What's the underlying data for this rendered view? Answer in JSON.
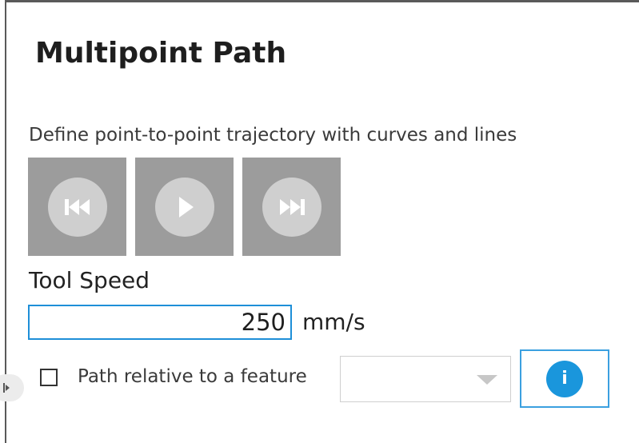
{
  "panel": {
    "title": "Multipoint Path",
    "description": "Define point-to-point trajectory with curves and lines"
  },
  "playback": {
    "buttons": [
      {
        "name": "previous",
        "icon": "skip-back-icon"
      },
      {
        "name": "play",
        "icon": "play-icon"
      },
      {
        "name": "next",
        "icon": "skip-forward-icon"
      }
    ]
  },
  "tool_speed": {
    "label": "Tool Speed",
    "value": "250",
    "unit": "mm/s"
  },
  "feature": {
    "checkbox_label": "Path relative to a feature",
    "checked": false,
    "selected_value": "",
    "info_label": "i"
  },
  "colors": {
    "accent": "#1a96dc",
    "button_gray": "#9c9c9c",
    "button_circle": "#cfcfcf"
  }
}
